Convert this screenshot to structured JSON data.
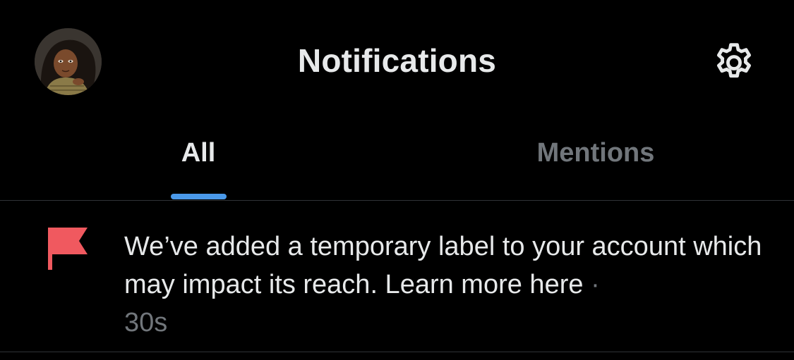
{
  "header": {
    "title": "Notifications",
    "avatar_icon": "user-avatar",
    "settings_icon": "gear-icon"
  },
  "tabs": [
    {
      "label": "All",
      "active": true
    },
    {
      "label": "Mentions",
      "active": false
    }
  ],
  "notifications": [
    {
      "icon": "flag-icon",
      "text": "We’ve added a temporary label to your account which may impact its reach. Learn more here",
      "separator": "·",
      "time": "30s"
    }
  ],
  "colors": {
    "background": "#000000",
    "primary_text": "#e7e9ea",
    "secondary_text": "#71767b",
    "accent": "#1d9bf0",
    "flag": "#f4212e",
    "divider": "#2f3336"
  }
}
